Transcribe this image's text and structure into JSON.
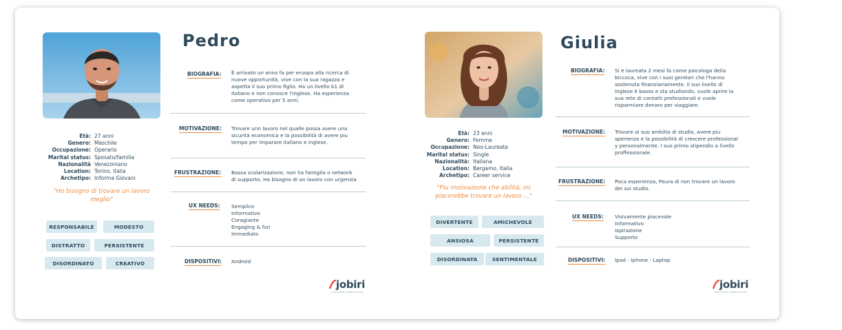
{
  "personas": [
    {
      "name": "Pedro",
      "stats": [
        {
          "label": "Età:",
          "value": "27 anni"
        },
        {
          "label": "Genero:",
          "value": "Maschile"
        },
        {
          "label": "Occupazione:",
          "value": "Operario"
        },
        {
          "label": "Marital status:",
          "value": "Sposato/familia"
        },
        {
          "label": "Nazionalità",
          "value": "Venezoniano"
        },
        {
          "label": "Location:",
          "value": "Torino, italia"
        },
        {
          "label": "Archetipo:",
          "value": "Informa Giovani"
        }
      ],
      "quote": "\"Ho bisogno di trovare un lavoro meglio\"",
      "tags": [
        "RESPONSABILE",
        "MODESTO",
        "DISTRATTO",
        "PERSISTENTE",
        "DISORDINATO",
        "CREATIVO"
      ],
      "sections": [
        {
          "label": "BIOGRAFIA:",
          "lines": [
            "È arrivato un anno fa per eruopa alla ricerca di",
            "nuove opportunità, vive con la sua ragazza e",
            "aspetta il suo primo figlio. Ha un livello b1 di",
            "italiano e non conosce l'inglese. Ha esperienza",
            "come operativo per 5 anni."
          ]
        },
        {
          "label": "MOTIVAZIONE:",
          "lines": [
            "Trovare unn lavoro nel qualle possa avere una",
            "sicurità economica e la possibilità di avere piu",
            "tempo per imparare italiano e inglese."
          ]
        },
        {
          "label": "FRUSTRAZIONE:",
          "lines": [
            "Bassa scolarizazione, non ha famiglia o network",
            "di supporto, Ha bisogno di un lavoro con urgenzia"
          ]
        },
        {
          "label": "UX NEEDS:",
          "lines": [
            "Semplice",
            "Informativo",
            "Coragiante",
            "Engaging & fun",
            "Immediato"
          ]
        },
        {
          "label": "DISPOSITIVI:",
          "lines": [
            "Android"
          ]
        }
      ]
    },
    {
      "name": "Giulia",
      "stats": [
        {
          "label": "Età:",
          "value": "23 anni"
        },
        {
          "label": "Genero:",
          "value": "Femme"
        },
        {
          "label": "Occupazione:",
          "value": "Neo-Laureata"
        },
        {
          "label": "Marital status:",
          "value": "Single"
        },
        {
          "label": "Nazionalità:",
          "value": "Italiana"
        },
        {
          "label": "Location:",
          "value": "Bergamo, Italia"
        },
        {
          "label": "Archetipo:",
          "value": "Career service"
        }
      ],
      "quote": "\"Piu motivazione che abilità, mi piacerebbe trovare un lavoro ...\"",
      "tags": [
        "DIVERTENTE",
        "AMICHEVOLE",
        "ANSIOSA",
        "PERSISTENTE",
        "DISORDINATA",
        "SENTIMENTALE"
      ],
      "sections": [
        {
          "label": "BIOGRAFIA:",
          "lines": [
            "Si è laureata 2 mesi fa come psicologa della",
            "biccoca, vive con i suoi genitori che l'hanno",
            "sostenuta finanziariamente. Il suo livello di",
            "inglese è basso e sta studiando, vuole aprire la",
            "sua rete di contatti professionali e vuole",
            "risparmiare denaro per viaggiare."
          ]
        },
        {
          "label": "MOTIVAZIONE:",
          "lines": [
            "Trovare al suo ambitio di studio, avere piu",
            "sperienza e la possibilità di crescere professional",
            "y personalmente. I suo primo stipendio a livello",
            "proffessionale."
          ]
        },
        {
          "label": "FRUSTRAZIONE:",
          "lines": [
            "Poca esperienza, Paura di non trovare un lavoro",
            "dei sui studio."
          ]
        },
        {
          "label": "UX NEEDS:",
          "lines": [
            "Visivamente piacevole",
            "Informativo",
            "Ispirazione",
            "Supporto"
          ]
        },
        {
          "label": "DISPOSITIVI:",
          "lines": [
            "Ipad - Iphone - Laptop"
          ]
        }
      ]
    }
  ],
  "logo": {
    "word": "jobiri",
    "tagline": "YOUR DIGITAL CAREER ADVISOR"
  },
  "colors": {
    "accent": "#f08a3c",
    "text": "#2f4a5c",
    "tag_bg": "#d7e8ef",
    "divider": "#b9cbd3"
  }
}
